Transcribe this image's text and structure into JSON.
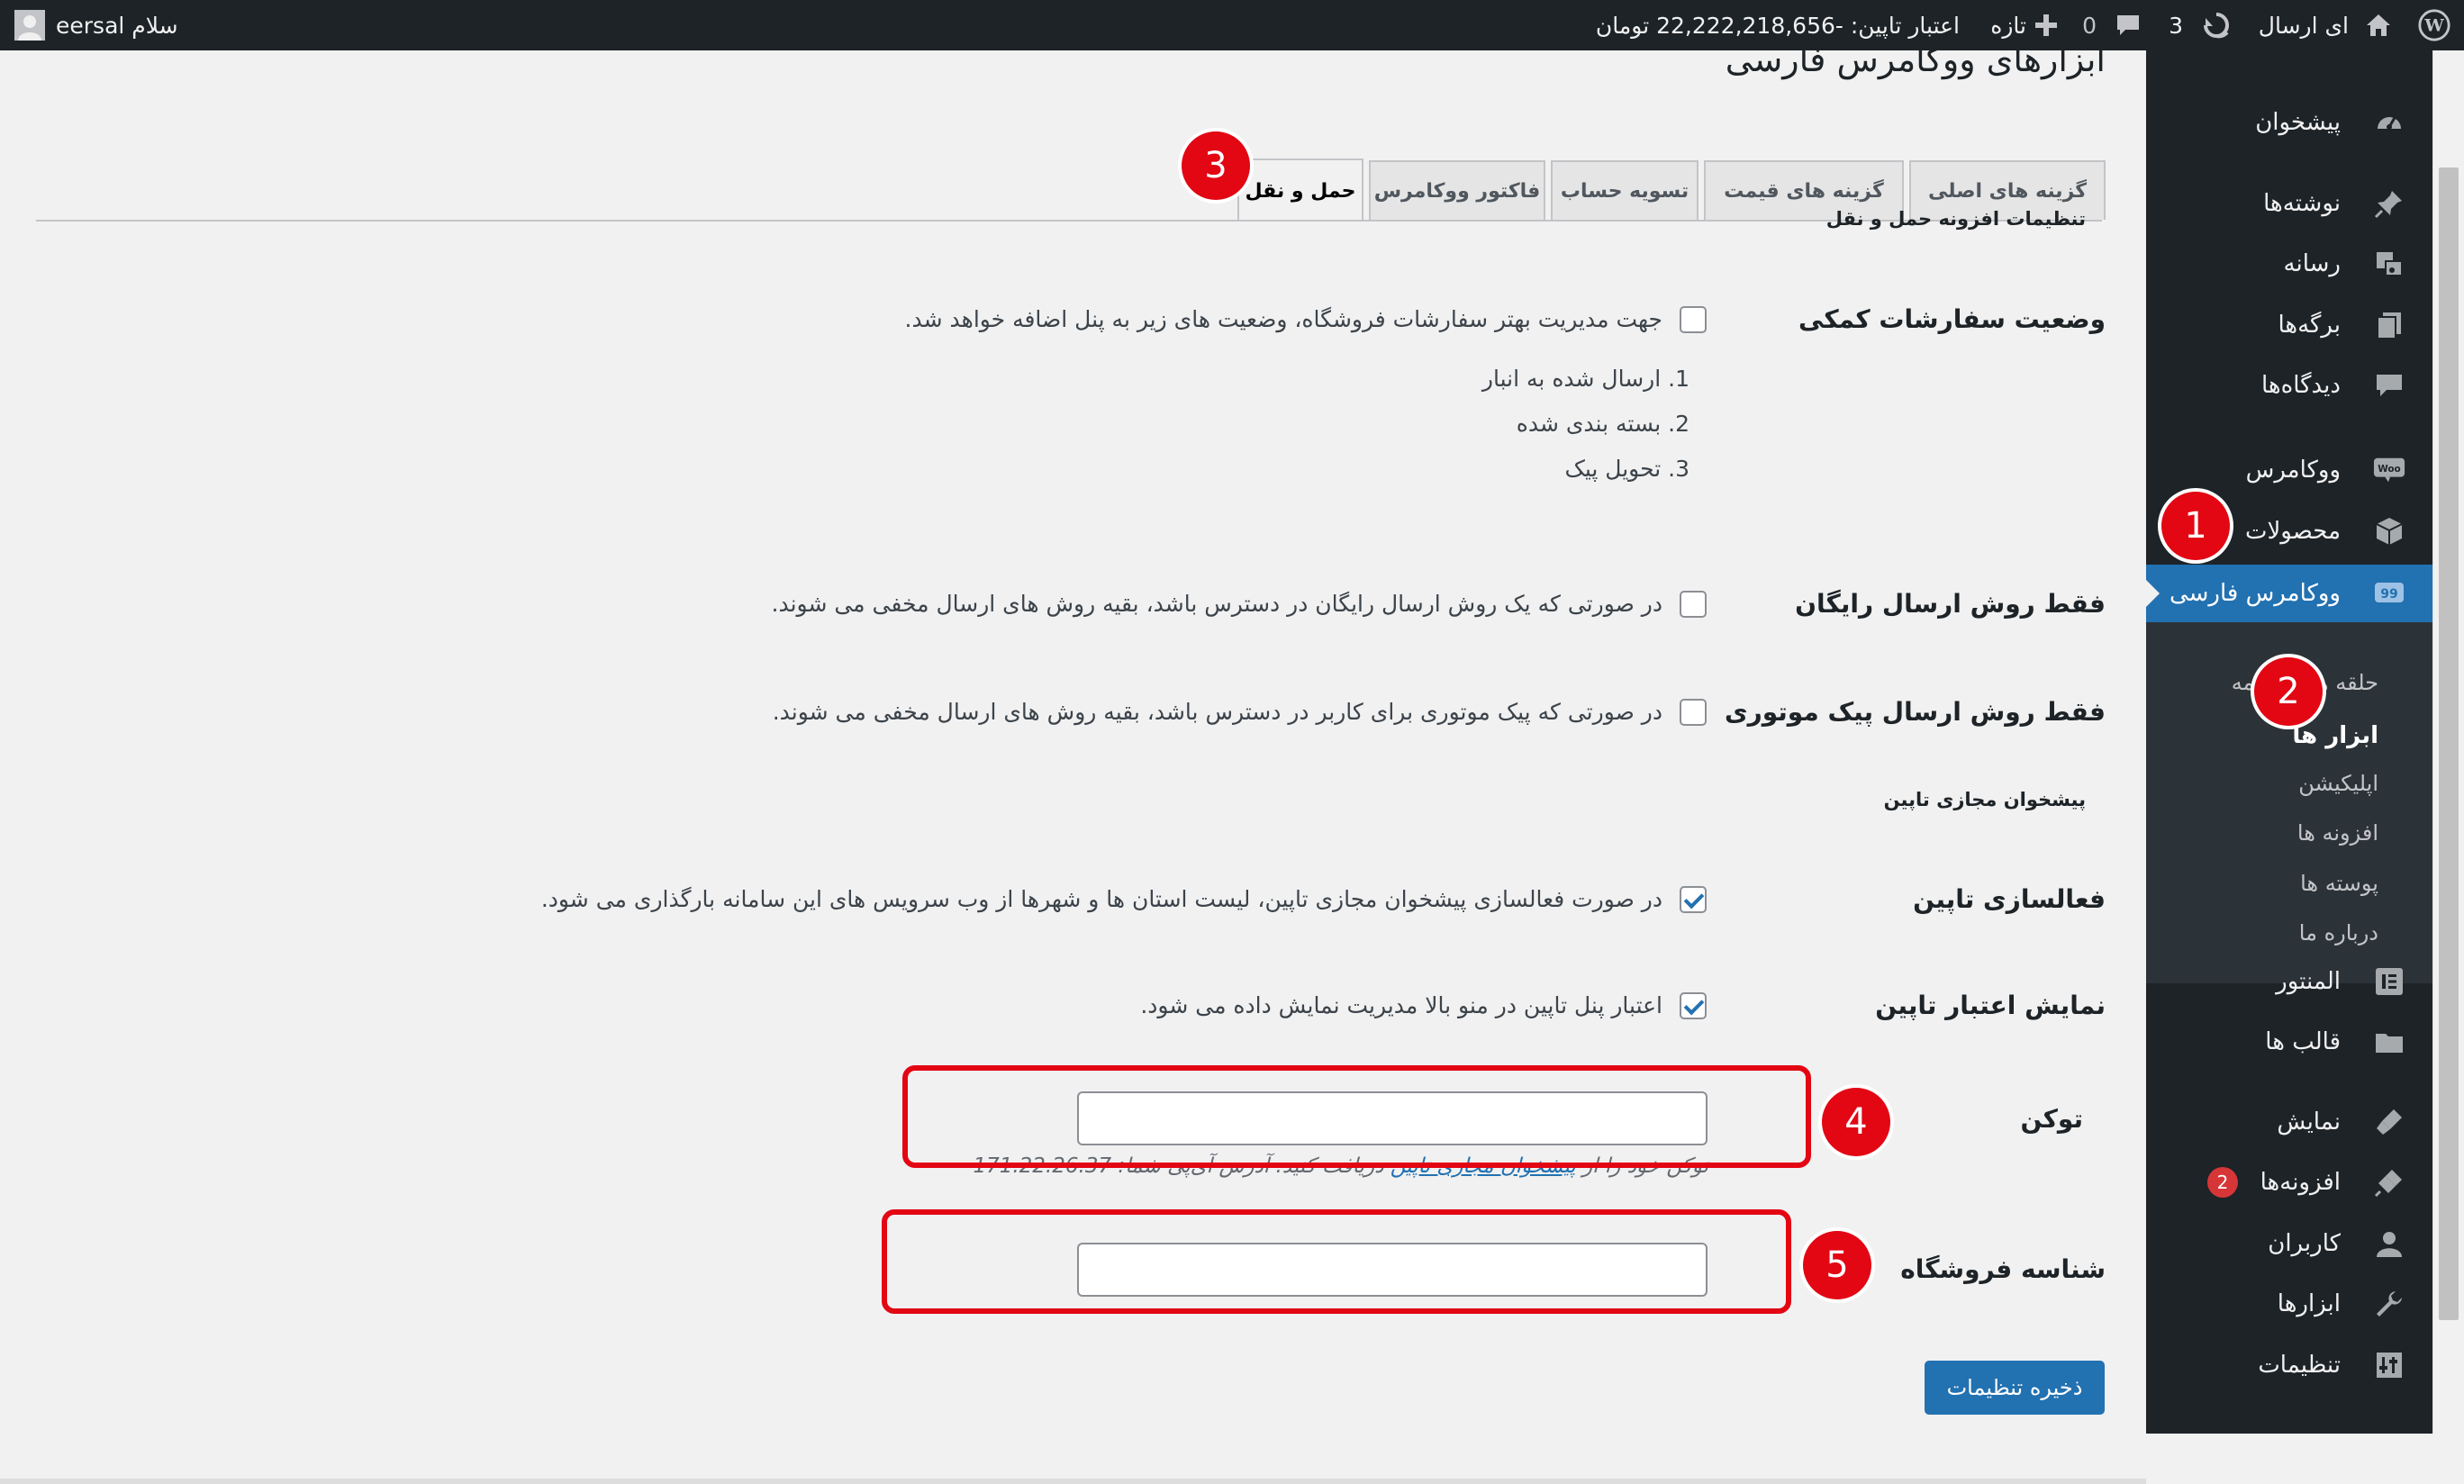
{
  "admin_bar": {
    "site_name": "ای ارسال",
    "updates_count": "3",
    "comments_count": "0",
    "new_label": "تازه",
    "credit": "اعتبار تاپین: -22,222,218,656 تومان",
    "greeting": "سلام eersal"
  },
  "sidebar": {
    "items": [
      {
        "label": "پیشخوان",
        "icon": "dashboard-icon"
      },
      {
        "label": "نوشته‌ها",
        "icon": "pin-icon"
      },
      {
        "label": "رسانه",
        "icon": "media-icon"
      },
      {
        "label": "برگه‌ها",
        "icon": "pages-icon"
      },
      {
        "label": "دیدگاه‌ها",
        "icon": "comments-icon"
      },
      {
        "label": "ووکامرس",
        "icon": "woo-icon"
      },
      {
        "label": "محصولات",
        "icon": "products-icon"
      },
      {
        "label": "ووکامرس فارسی",
        "icon": "persian-woo-icon"
      },
      {
        "label": "المنتور",
        "icon": "elementor-icon"
      },
      {
        "label": "قالب ها",
        "icon": "templates-icon"
      },
      {
        "label": "نمایش",
        "icon": "appearance-icon"
      },
      {
        "label": "افزونه‌ها",
        "icon": "plugins-icon",
        "badge": "2"
      },
      {
        "label": "کاربران",
        "icon": "users-icon"
      },
      {
        "label": "ابزارها",
        "icon": "tools-icon"
      },
      {
        "label": "تنظیمات",
        "icon": "settings-icon"
      }
    ],
    "submenu": [
      "حلقه های ترجمه",
      "ابزار ها",
      "اپلیکیشن",
      "افزونه ها",
      "پوسته ها",
      "درباره ما"
    ]
  },
  "page": {
    "title": "ابزارهای ووکامرس فارسی",
    "tabs": [
      "گزینه های اصلی",
      "گزینه های قیمت",
      "تسویه حساب",
      "فاکتور ووکامرس",
      "حمل و نقل"
    ],
    "section1_title": "تنظیمات افزونه حمل و نقل",
    "section2_title": "پیشخوان مجازی تاپین",
    "fields": {
      "order_status_label": "وضعیت سفارشات کمکی",
      "order_status_desc": "جهت مدیریت بهتر سفارشات فروشگاه، وضعیت های زیر به پنل اضافه خواهد شد.",
      "order_status_list": [
        "ارسال شده به انبار",
        "بسته بندی شده",
        "تحویل پیک"
      ],
      "free_only_label": "فقط روش ارسال رایگان",
      "free_only_desc": "در صورتی که یک روش ارسال رایگان در دسترس باشد، بقیه روش های ارسال مخفی می شوند.",
      "courier_only_label": "فقط روش ارسال پیک موتوری",
      "courier_only_desc": "در صورتی که پیک موتوری برای کاربر در دسترس باشد، بقیه روش های ارسال مخفی می شوند.",
      "tapin_enable_label": "فعالسازی تاپین",
      "tapin_enable_desc": "در صورت فعالسازی پیشخوان مجازی تاپین، لیست استان ها و شهرها از وب سرویس های این سامانه بارگذاری می شود.",
      "tapin_credit_label": "نمایش اعتبار تاپین",
      "tapin_credit_desc": "اعتبار پنل تاپین در منو بالا مدیریت نمایش داده می شود.",
      "token_label": "توکن",
      "token_value": "",
      "token_help_prefix": "توکن خود را از",
      "token_help_link": "پیشخوان مجازی تاپین",
      "token_help_suffix": "دریافت کنید. آدرس آی‌پی شما: 171.22.26.37",
      "shop_id_label": "شناسه فروشگاه",
      "shop_id_value": ""
    },
    "save_button": "ذخیره تنظیمات"
  },
  "annotations": [
    "1",
    "2",
    "3",
    "4",
    "5"
  ],
  "colors": {
    "admin_dark": "#1d2327",
    "accent": "#2271b1",
    "annotation_red": "#e30613"
  }
}
